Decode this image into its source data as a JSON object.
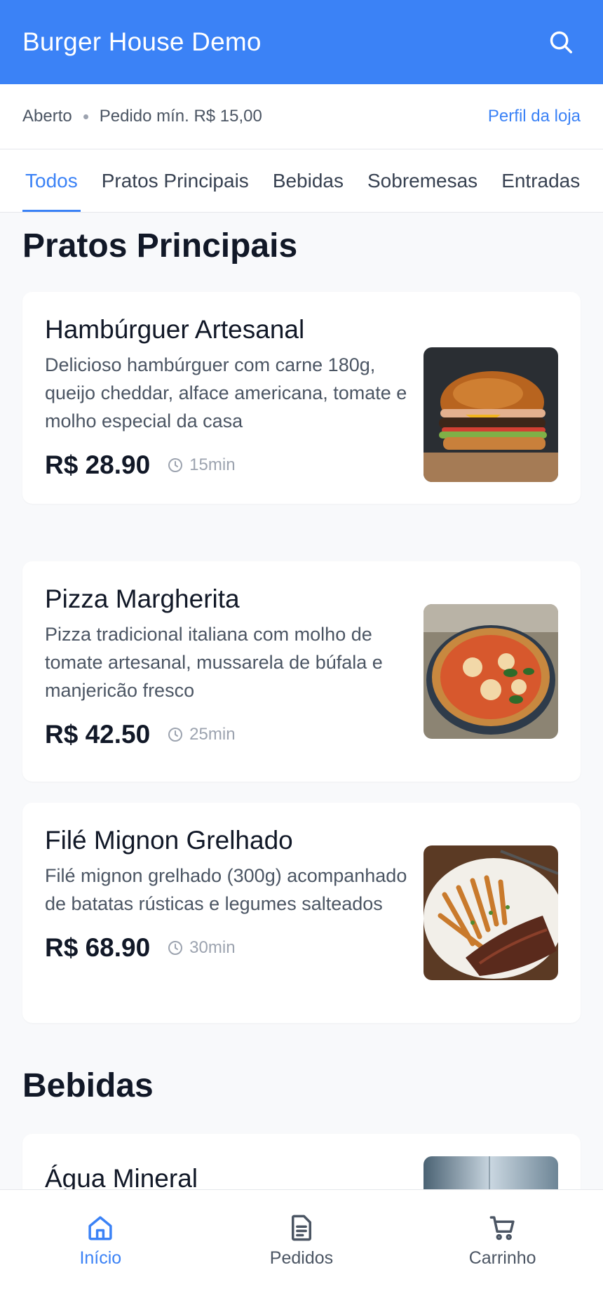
{
  "header": {
    "title": "Burger House Demo",
    "search_icon": "search-icon"
  },
  "info": {
    "status": "Aberto",
    "min_order": "Pedido mín. R$ 15,00",
    "store_link": "Perfil da loja"
  },
  "tabs": [
    {
      "label": "Todos",
      "active": true
    },
    {
      "label": "Pratos Principais",
      "active": false
    },
    {
      "label": "Bebidas",
      "active": false
    },
    {
      "label": "Sobremesas",
      "active": false
    },
    {
      "label": "Entradas",
      "active": false
    }
  ],
  "sections": [
    {
      "title": "Pratos Principais",
      "items": [
        {
          "name": "Hambúrguer Artesanal",
          "description": "Delicioso hambúrguer com carne 180g, queijo cheddar, alface americana, tomate e molho especial da casa",
          "price": "R$ 28.90",
          "time": "15min",
          "image": "burger-photo"
        },
        {
          "name": "Pizza Margherita",
          "description": "Pizza tradicional italiana com molho de tomate artesanal, mussarela de búfala e manjericão fresco",
          "price": "R$ 42.50",
          "time": "25min",
          "image": "pizza-photo"
        },
        {
          "name": "Filé Mignon Grelhado",
          "description": "Filé mignon grelhado (300g) acompanhado de batatas rústicas e legumes salteados",
          "price": "R$ 68.90",
          "time": "30min",
          "image": "steak-photo"
        }
      ]
    },
    {
      "title": "Bebidas",
      "items": [
        {
          "name": "Água Mineral",
          "image": "water-photo"
        }
      ]
    }
  ],
  "bottom_nav": [
    {
      "label": "Início",
      "icon": "home-icon",
      "active": true
    },
    {
      "label": "Pedidos",
      "icon": "receipt-icon",
      "active": false
    },
    {
      "label": "Carrinho",
      "icon": "cart-icon",
      "active": false
    }
  ],
  "colors": {
    "primary": "#3b82f6",
    "text": "#111827",
    "muted": "#4b5563",
    "background": "#f8f9fb"
  }
}
